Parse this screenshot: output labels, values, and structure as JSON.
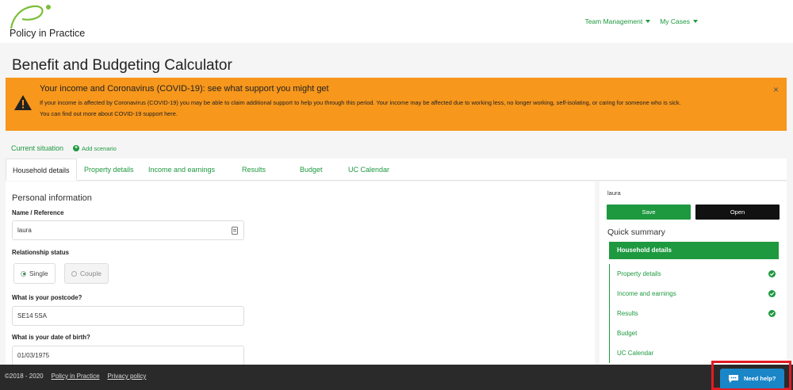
{
  "brand": {
    "name": "Policy in Practice",
    "green": "#1e9940",
    "orange": "#f7971c"
  },
  "topnav": {
    "items": [
      {
        "label": "Team Management"
      },
      {
        "label": "My Cases"
      }
    ]
  },
  "page": {
    "title": "Benefit and Budgeting Calculator"
  },
  "alert": {
    "title": "Your income and Coronavirus (COVID-19): see what support you might get",
    "line1": "If your income is affected by Coronavirus (COVID-19) you may be able to claim additional support to help you through this period. Your income may be affected due to working less, no longer working, self-isolating, or caring for someone who is sick.",
    "line2": "You can find out more about COVID-19 support here.",
    "close": "×"
  },
  "scenarios": {
    "current": "Current situation",
    "add": "Add scenario"
  },
  "tabs": [
    {
      "label": "Household details"
    },
    {
      "label": "Property details"
    },
    {
      "label": "Income and earnings"
    },
    {
      "label": "Results"
    },
    {
      "label": "Budget"
    },
    {
      "label": "UC Calendar"
    }
  ],
  "form": {
    "section_title": "Personal information",
    "name": {
      "label": "Name / Reference",
      "value": "laura"
    },
    "relationship": {
      "label": "Relationship status",
      "options": [
        "Single",
        "Couple"
      ],
      "selected": "Single"
    },
    "postcode": {
      "label": "What is your postcode?",
      "value": "SE14 5SA"
    },
    "dob": {
      "label": "What is your date of birth?",
      "value": "01/03/1975"
    }
  },
  "side": {
    "name": "laura",
    "save": "Save",
    "open": "Open",
    "summary_title": "Quick summary",
    "items": [
      {
        "label": "Household details",
        "complete": false
      },
      {
        "label": "Property details",
        "complete": true
      },
      {
        "label": "Income and earnings",
        "complete": true
      },
      {
        "label": "Results",
        "complete": true
      },
      {
        "label": "Budget",
        "complete": false
      },
      {
        "label": "UC Calendar",
        "complete": false
      }
    ]
  },
  "footer": {
    "copyright": "©2018 - 2020",
    "link1": "Policy in Practice",
    "link2": "Privacy policy"
  },
  "help": {
    "label": "Need help?"
  }
}
